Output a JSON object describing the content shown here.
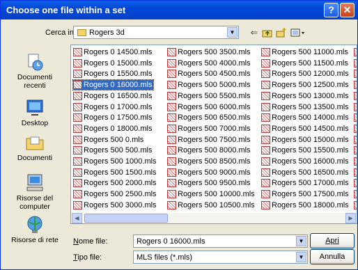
{
  "dialog": {
    "title": "Choose one file within a set",
    "help_glyph": "?",
    "close_glyph": "✕"
  },
  "toolbar": {
    "lookin_label": "Cerca in:",
    "lookin_value": "Rogers 3d",
    "back_icon": "back-arrow-icon",
    "up_icon": "folder-up-icon",
    "newfolder_icon": "new-folder-icon",
    "views_icon": "view-menu-icon"
  },
  "places": [
    {
      "label_lines": [
        "Documenti",
        "recenti"
      ]
    },
    {
      "label_lines": [
        "Desktop"
      ]
    },
    {
      "label_lines": [
        "Documenti"
      ]
    },
    {
      "label_lines": [
        "Risorse del",
        "computer"
      ]
    },
    {
      "label_lines": [
        "Risorse di rete"
      ]
    }
  ],
  "files": {
    "columns": [
      [
        "Rogers 0 14500.mls",
        "Rogers 0 15000.mls",
        "Rogers 0 15500.mls",
        "Rogers 0 16000.mls",
        "Rogers 0 16500.mls",
        "Rogers 0 17000.mls",
        "Rogers 0 17500.mls",
        "Rogers 0 18000.mls",
        "Rogers 500 0.mls",
        "Rogers 500 500.mls",
        "Rogers 500 1000.mls",
        "Rogers 500 1500.mls",
        "Rogers 500 2000.mls",
        "Rogers 500 2500.mls",
        "Rogers 500 3000.mls"
      ],
      [
        "Rogers 500 3500.mls",
        "Rogers 500 4000.mls",
        "Rogers 500 4500.mls",
        "Rogers 500 5000.mls",
        "Rogers 500 5500.mls",
        "Rogers 500 6000.mls",
        "Rogers 500 6500.mls",
        "Rogers 500 7000.mls",
        "Rogers 500 7500.mls",
        "Rogers 500 8000.mls",
        "Rogers 500 8500.mls",
        "Rogers 500 9000.mls",
        "Rogers 500 9500.mls",
        "Rogers 500 10000.mls",
        "Rogers 500 10500.mls"
      ],
      [
        "Rogers 500 11000.mls",
        "Rogers 500 11500.mls",
        "Rogers 500 12000.mls",
        "Rogers 500 12500.mls",
        "Rogers 500 13000.mls",
        "Rogers 500 13500.mls",
        "Rogers 500 14000.mls",
        "Rogers 500 14500.mls",
        "Rogers 500 15000.mls",
        "Rogers 500 15500.mls",
        "Rogers 500 16000.mls",
        "Rogers 500 16500.mls",
        "Rogers 500 17000.mls",
        "Rogers 500 17500.mls",
        "Rogers 500 18000.mls"
      ]
    ],
    "selected": "Rogers 0 16000.mls"
  },
  "form": {
    "filename_label": "Nome file:",
    "filename_value": "Rogers 0 16000.mls",
    "filetype_label": "Tipo file:",
    "filetype_value": "MLS files (*.mls)",
    "open_button": "Apri",
    "cancel_button": "Annulla"
  }
}
